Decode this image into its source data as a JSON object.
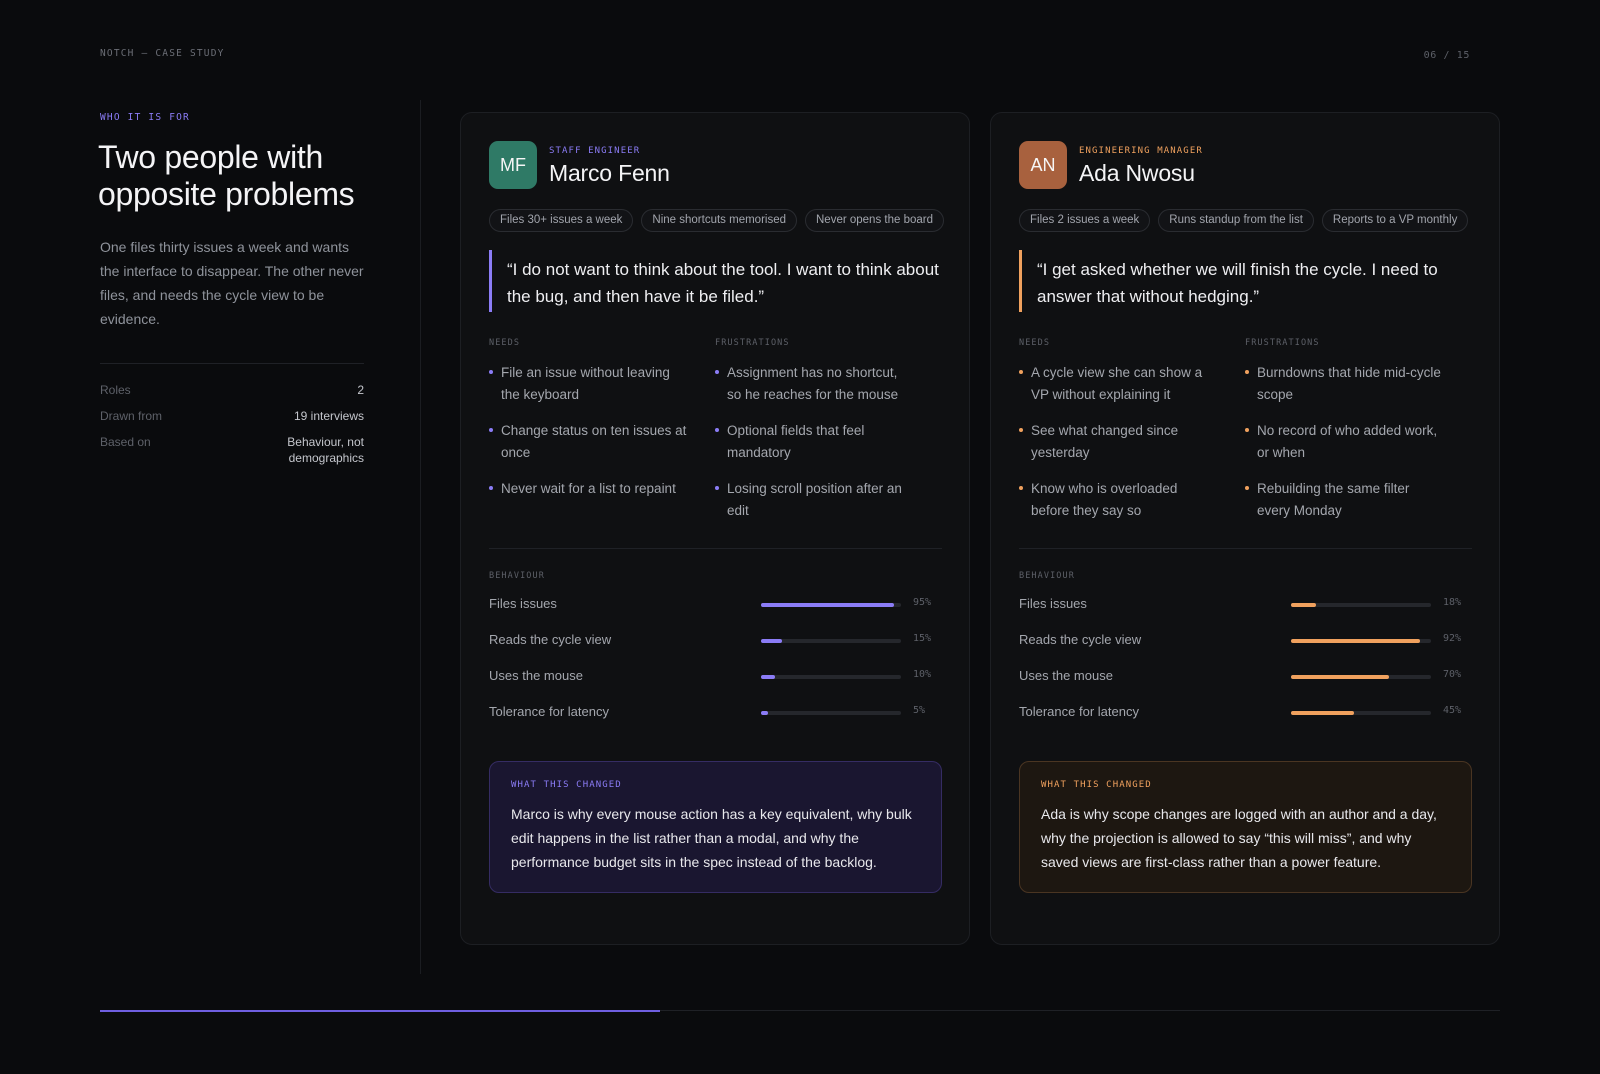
{
  "header": {
    "label": "NOTCH — CASE STUDY",
    "page_counter": "06 / 15"
  },
  "intro": {
    "eyebrow": "WHO IT IS FOR",
    "title": "Two people with opposite problems",
    "body": "One files thirty issues a week and wants the interface to disappear. The other never files, and needs the cycle view to be evidence.",
    "meta": [
      {
        "key": "Roles",
        "value": "2"
      },
      {
        "key": "Drawn from",
        "value": "19 interviews"
      },
      {
        "key": "Based on",
        "value": "Behaviour, not demographics"
      }
    ]
  },
  "personas": [
    {
      "accent": "#8b7cf6",
      "avatar_color": "#2f7a66",
      "initials": "MF",
      "role": "STAFF ENGINEER",
      "name": "Marco Fenn",
      "chips": [
        "Files 30+ issues a week",
        "Nine shortcuts memorised",
        "Never opens the board"
      ],
      "quote": "“I do not want to think about the tool. I want to think about the bug, and then have it be filed.”",
      "needs_title": "NEEDS",
      "needs": [
        "File an issue without leaving the keyboard",
        "Change status on ten issues at once",
        "Never wait for a list to repaint"
      ],
      "frustrations_title": "FRUSTRATIONS",
      "frustrations": [
        "Assignment has no shortcut, so he reaches for the mouse",
        "Optional fields that feel mandatory",
        "Losing scroll position after an edit"
      ],
      "behaviour_title": "BEHAVIOUR",
      "behaviour": [
        {
          "label": "Files issues",
          "value": 95,
          "display": "95%"
        },
        {
          "label": "Reads the cycle view",
          "value": 15,
          "display": "15%"
        },
        {
          "label": "Uses the mouse",
          "value": 10,
          "display": "10%"
        },
        {
          "label": "Tolerance for latency",
          "value": 5,
          "display": "5%"
        }
      ],
      "changed_title": "WHAT THIS CHANGED",
      "changed_text": "Marco is why every mouse action has a key equivalent, why bulk edit happens in the list rather than a modal, and why the performance budget sits in the spec instead of the backlog.",
      "changed_bg": "#1a1630",
      "changed_border": "#352c63"
    },
    {
      "accent": "#f0a15e",
      "avatar_color": "#a8613e",
      "initials": "AN",
      "role": "ENGINEERING MANAGER",
      "name": "Ada Nwosu",
      "chips": [
        "Files 2 issues a week",
        "Runs standup from the list",
        "Reports to a VP monthly"
      ],
      "quote": "“I get asked whether we will finish the cycle. I need to answer that without hedging.”",
      "needs_title": "NEEDS",
      "needs": [
        "A cycle view she can show a VP without explaining it",
        "See what changed since yesterday",
        "Know who is overloaded before they say so"
      ],
      "frustrations_title": "FRUSTRATIONS",
      "frustrations": [
        "Burndowns that hide mid-cycle scope",
        "No record of who added work, or when",
        "Rebuilding the same filter every Monday"
      ],
      "behaviour_title": "BEHAVIOUR",
      "behaviour": [
        {
          "label": "Files issues",
          "value": 18,
          "display": "18%"
        },
        {
          "label": "Reads the cycle view",
          "value": 92,
          "display": "92%"
        },
        {
          "label": "Uses the mouse",
          "value": 70,
          "display": "70%"
        },
        {
          "label": "Tolerance for latency",
          "value": 45,
          "display": "45%"
        }
      ],
      "changed_title": "WHAT THIS CHANGED",
      "changed_text": "Ada is why scope changes are logged with an author and a day, why the projection is allowed to say “this will miss”, and why saved views are first-class rather than a power feature.",
      "changed_bg": "#1d1711",
      "changed_border": "#4a3522"
    }
  ],
  "deck_progress": 0.4
}
